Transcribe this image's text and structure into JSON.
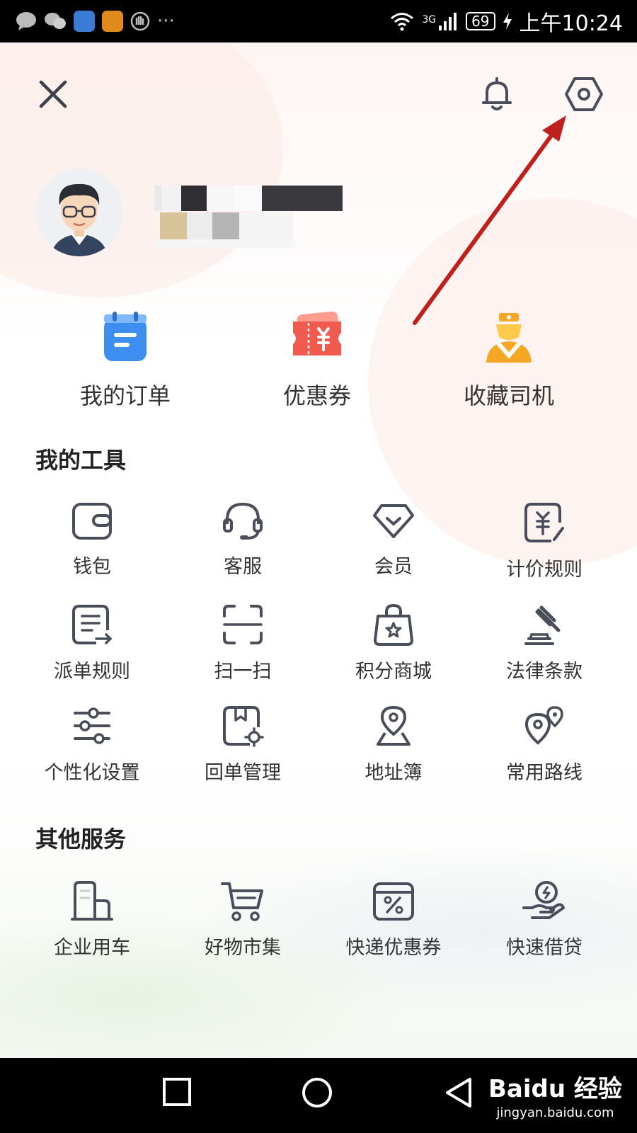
{
  "status_bar": {
    "dots": "···",
    "network": "3G",
    "battery": "69",
    "time": "上午10:24"
  },
  "quick_actions": [
    {
      "label": "我的订单",
      "icon": "order-icon"
    },
    {
      "label": "优惠券",
      "icon": "coupon-icon"
    },
    {
      "label": "收藏司机",
      "icon": "driver-icon"
    }
  ],
  "tools": {
    "title": "我的工具",
    "items": [
      {
        "label": "钱包",
        "icon": "wallet-icon"
      },
      {
        "label": "客服",
        "icon": "headset-icon"
      },
      {
        "label": "会员",
        "icon": "diamond-icon"
      },
      {
        "label": "计价规则",
        "icon": "pricing-rule-icon"
      },
      {
        "label": "派单规则",
        "icon": "dispatch-rule-icon"
      },
      {
        "label": "扫一扫",
        "icon": "scan-icon"
      },
      {
        "label": "积分商城",
        "icon": "shopping-bag-icon"
      },
      {
        "label": "法律条款",
        "icon": "gavel-icon"
      },
      {
        "label": "个性化设置",
        "icon": "sliders-icon"
      },
      {
        "label": "回单管理",
        "icon": "receipt-manage-icon"
      },
      {
        "label": "地址簿",
        "icon": "location-pin-icon"
      },
      {
        "label": "常用路线",
        "icon": "route-icon"
      }
    ]
  },
  "services": {
    "title": "其他服务",
    "items": [
      {
        "label": "企业用车",
        "icon": "building-icon"
      },
      {
        "label": "好物市集",
        "icon": "cart-icon"
      },
      {
        "label": "快递优惠券",
        "icon": "parcel-discount-icon"
      },
      {
        "label": "快速借贷",
        "icon": "loan-icon"
      }
    ]
  },
  "watermark": {
    "main": "Baidu 经验",
    "sub": "jingyan.baidu.com"
  },
  "colors": {
    "annotation_arrow": "#c0201c",
    "icon_stroke": "#4a4e5a",
    "order_blue": "#3d8ef0",
    "coupon_red": "#f05a4f",
    "driver_orange": "#f5a623"
  }
}
